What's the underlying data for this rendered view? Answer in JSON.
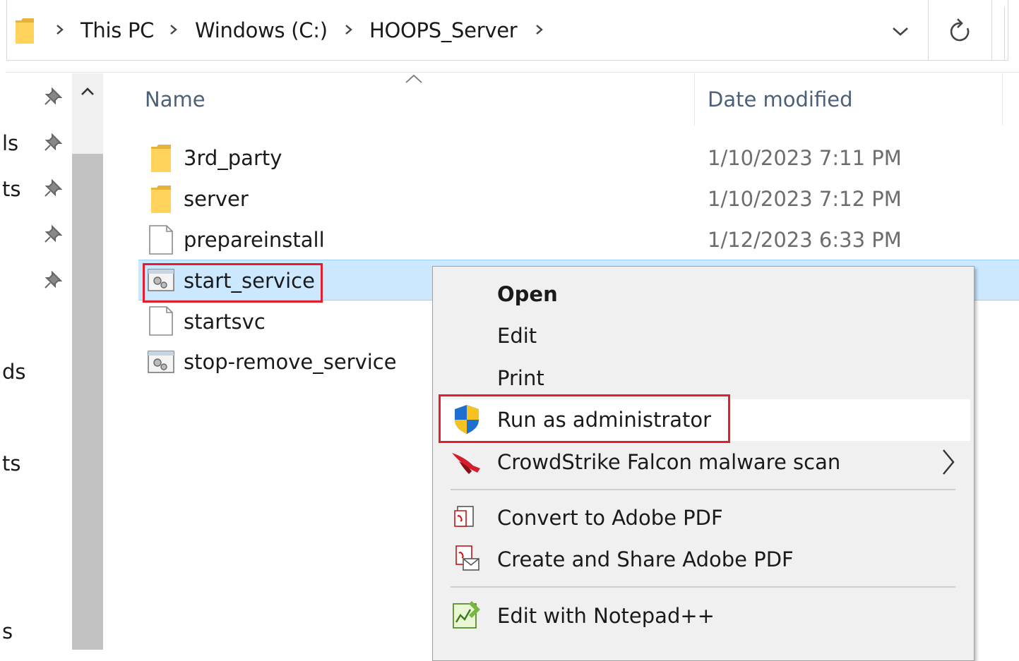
{
  "address_bar": {
    "breadcrumbs": [
      "This PC",
      "Windows (C:)",
      "HOOPS_Server"
    ],
    "folder_icon": "folder-icon",
    "dropdown_icon": "chevron-down-icon",
    "refresh_icon": "refresh-icon"
  },
  "nav_pane": {
    "items": [
      "ls",
      "ts",
      "ds",
      "ts",
      "s"
    ]
  },
  "columns": {
    "name": "Name",
    "date_modified": "Date modified"
  },
  "files": [
    {
      "name": "3rd_party",
      "date": "1/10/2023 7:11 PM",
      "icon": "folder-icon"
    },
    {
      "name": "server",
      "date": "1/10/2023 7:12 PM",
      "icon": "folder-icon"
    },
    {
      "name": "prepareinstall",
      "date": "1/12/2023 6:33 PM",
      "icon": "file-icon"
    },
    {
      "name": "start_service",
      "date": "",
      "icon": "batch-file-icon",
      "selected": true
    },
    {
      "name": "startsvc",
      "date": "",
      "icon": "file-icon"
    },
    {
      "name": "stop-remove_service",
      "date": "",
      "icon": "batch-file-icon"
    }
  ],
  "context_menu": {
    "open": "Open",
    "edit": "Edit",
    "print": "Print",
    "run_as_admin": "Run as administrator",
    "crowdstrike": "CrowdStrike Falcon malware scan",
    "convert_pdf": "Convert to Adobe PDF",
    "share_pdf": "Create and Share Adobe PDF",
    "notepadpp": "Edit with Notepad++"
  },
  "colors": {
    "selection": "#cce8ff",
    "highlight_box": "#e0202f",
    "menu_bg": "#f0f0f0"
  }
}
